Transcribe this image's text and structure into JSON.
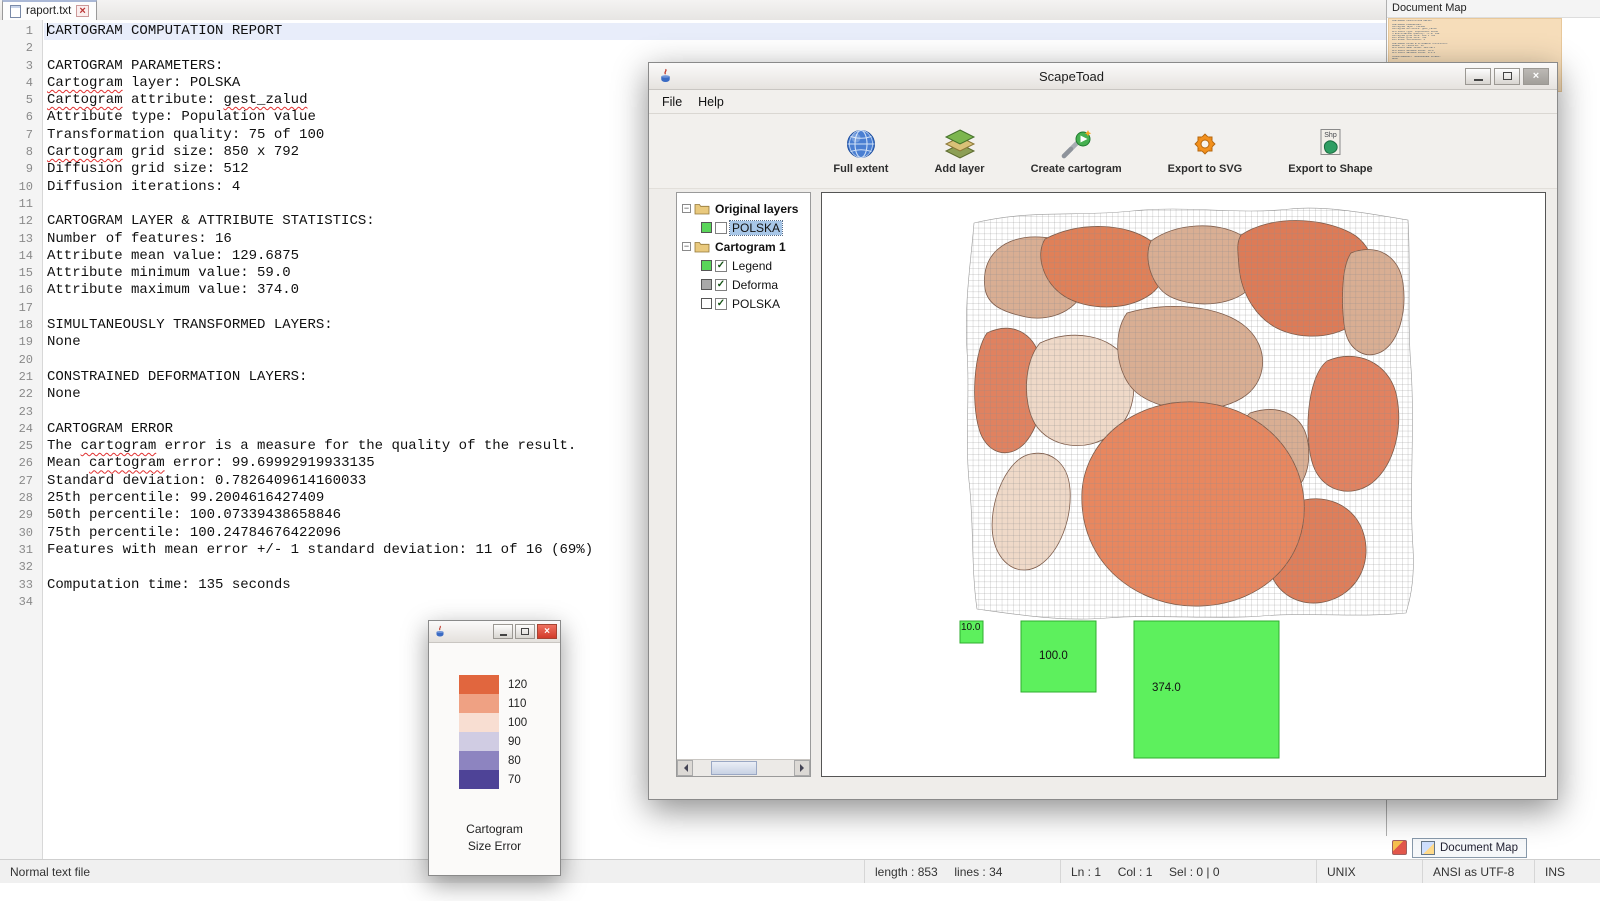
{
  "app": {
    "tab": {
      "title": "raport.txt",
      "close_glyph": "×"
    },
    "document_map": {
      "title": "Document Map",
      "bottom_tab": "Document Map"
    },
    "status_bar": {
      "doc_type": "Normal text file",
      "length_lines": "length : 853     lines : 34",
      "cursor": "Ln : 1     Col : 1     Sel : 0 | 0",
      "eol": "UNIX",
      "encoding": "ANSI as UTF-8",
      "typing_mode": "INS"
    }
  },
  "editor": {
    "current_line": 1,
    "misspelled": [
      "Cartogram",
      "cartogram",
      "gest_zalud"
    ],
    "lines": [
      "CARTOGRAM COMPUTATION REPORT",
      "",
      "CARTOGRAM PARAMETERS:",
      "Cartogram layer: POLSKA",
      "Cartogram attribute: gest_zalud",
      "Attribute type: Population value",
      "Transformation quality: 75 of 100",
      "Cartogram grid size: 850 x 792",
      "Diffusion grid size: 512",
      "Diffusion iterations: 4",
      "",
      "CARTOGRAM LAYER & ATTRIBUTE STATISTICS:",
      "Number of features: 16",
      "Attribute mean value: 129.6875",
      "Attribute minimum value: 59.0",
      "Attribute maximum value: 374.0",
      "",
      "SIMULTANEOUSLY TRANSFORMED LAYERS:",
      "None",
      "",
      "CONSTRAINED DEFORMATION LAYERS:",
      "None",
      "",
      "CARTOGRAM ERROR",
      "The cartogram error is a measure for the quality of the result.",
      "Mean cartogram error: 99.69992919933135",
      "Standard deviation: 0.7826409614160033",
      "25th percentile: 99.2004616427409",
      "50th percentile: 100.07339438658846",
      "75th percentile: 100.24784676422096",
      "Features with mean error +/- 1 standard deviation: 11 of 16 (69%)",
      "",
      "Computation time: 135 seconds",
      ""
    ]
  },
  "scapetoad": {
    "title": "ScapeToad",
    "controls": {
      "minimize": "–",
      "maximize": "□",
      "close": "×"
    },
    "menu": [
      "File",
      "Help"
    ],
    "toolbar": [
      {
        "label": "Full extent",
        "icon": "globe-icon"
      },
      {
        "label": "Add layer",
        "icon": "layers-icon"
      },
      {
        "label": "Create cartogram",
        "icon": "wand-icon"
      },
      {
        "label": "Export to SVG",
        "icon": "gear-icon"
      },
      {
        "label": "Export to Shape",
        "icon": "shape-icon"
      }
    ],
    "tree": [
      {
        "kind": "folder",
        "label": "Original layers"
      },
      {
        "kind": "layer",
        "label": "POLSKA",
        "color": "#5ad55a",
        "checked": false,
        "selected": true
      },
      {
        "kind": "folder",
        "label": "Cartogram 1"
      },
      {
        "kind": "layer",
        "label": "Legend",
        "color": "#5ad55a",
        "checked": true,
        "selected": false
      },
      {
        "kind": "layer",
        "label": "Deforma",
        "color": "#a9a9a9",
        "checked": true,
        "selected": false
      },
      {
        "kind": "layer",
        "label": "POLSKA",
        "color": "#ffffff",
        "checked": true,
        "selected": false
      }
    ],
    "legend": {
      "values": [
        10,
        100,
        374
      ],
      "labels": [
        "10.0",
        "100.0",
        "374.0"
      ],
      "fill": "#5df05d",
      "stroke": "#2fae2f"
    }
  },
  "size_error_window": {
    "controls": {
      "minimize": "–",
      "maximize": "□",
      "close": "×"
    },
    "caption_lines": [
      "Cartogram",
      "Size Error"
    ],
    "scale": [
      {
        "label": "120",
        "color": "#e1663e"
      },
      {
        "label": "110",
        "color": "#efa183"
      },
      {
        "label": "100",
        "color": "#f8ded2"
      },
      {
        "label": "90",
        "color": "#d0cce3"
      },
      {
        "label": "80",
        "color": "#8d84c0"
      },
      {
        "label": "70",
        "color": "#4e4397"
      }
    ]
  }
}
